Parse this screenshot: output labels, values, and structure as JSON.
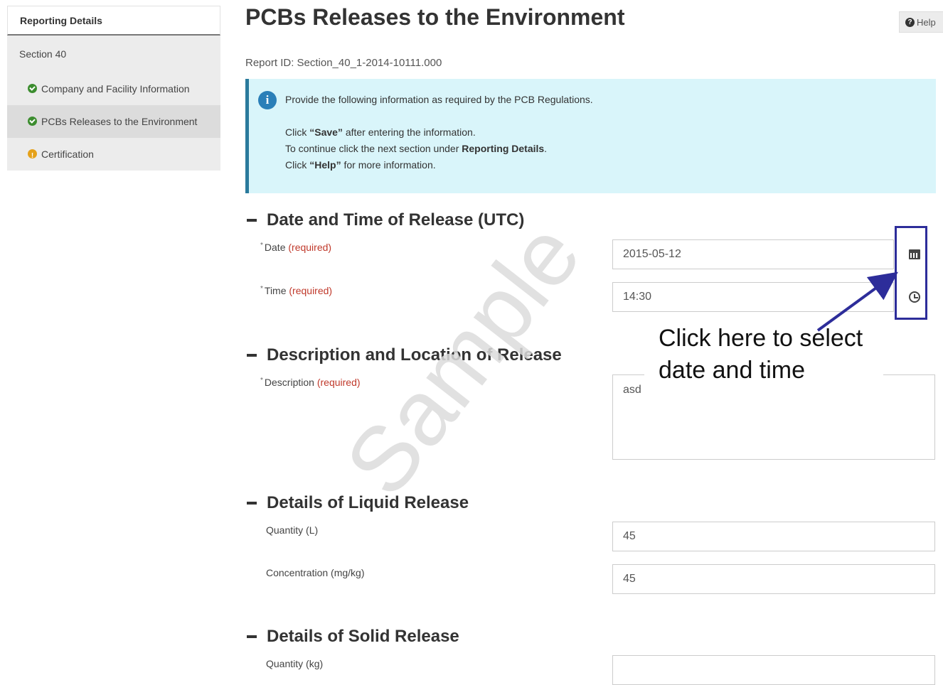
{
  "sidebar": {
    "header": "Reporting Details",
    "section": "Section 40",
    "items": [
      {
        "label": "Company and Facility Information",
        "status": "complete",
        "icon": "check-circle-icon"
      },
      {
        "label": "PCBs Releases to the Environment",
        "status": "complete",
        "icon": "check-circle-icon"
      },
      {
        "label": "Certification",
        "status": "incomplete",
        "icon": "warning-circle-icon"
      }
    ]
  },
  "header": {
    "title": "PCBs Releases to the Environment",
    "help_label": "Help"
  },
  "report_id": "Report ID: Section_40_1-2014-10111.000",
  "info": {
    "line1": "Provide the following information as required by the PCB Regulations.",
    "line2_pre": "Click ",
    "line2_bold": "“Save”",
    "line2_post": " after entering the information.",
    "line3_pre": "To continue click the next section under ",
    "line3_bold": "Reporting Details",
    "line3_post": ".",
    "line4_pre": "Click ",
    "line4_bold": "“Help”",
    "line4_post": " for more information."
  },
  "sections": {
    "datetime": {
      "heading": "Date and Time of Release (UTC)",
      "date_label": "Date",
      "time_label": "Time",
      "required": "(required)",
      "date_value": "2015-05-12",
      "time_value": "14:30"
    },
    "description": {
      "heading": "Description and Location of Release",
      "label": "Description",
      "required": "(required)",
      "value": "asd"
    },
    "liquid": {
      "heading": "Details of Liquid Release",
      "quantity_label": "Quantity (L)",
      "quantity_value": "45",
      "concentration_label": "Concentration (mg/kg)",
      "concentration_value": "45"
    },
    "solid": {
      "heading": "Details of Solid Release",
      "quantity_label": "Quantity (kg)",
      "quantity_value": ""
    }
  },
  "annotation": {
    "callout": "Click here to select date and time",
    "watermark": "Sample",
    "color": "#2d2d9a"
  }
}
